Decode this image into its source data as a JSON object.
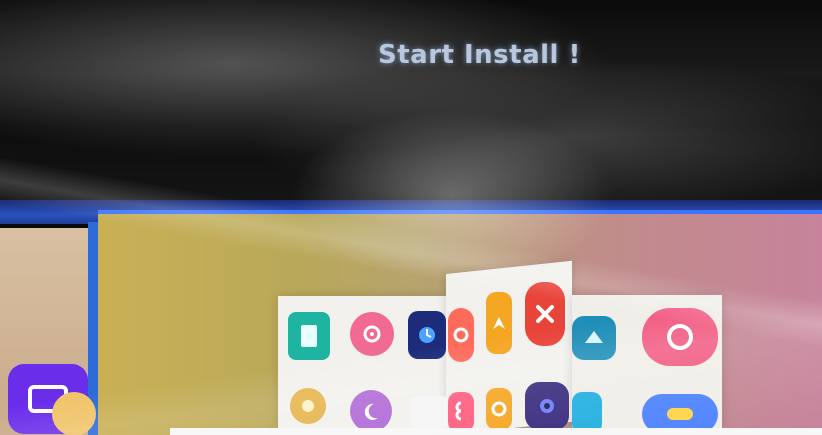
{
  "screen": {
    "title": "Start Install !"
  },
  "icons": [
    "document-icon",
    "gear-icon",
    "clock-icon",
    "settings-icon",
    "compass-icon",
    "close-icon",
    "mail-icon",
    "music-icon",
    "medal-icon",
    "moon-icon",
    "window-icon",
    "number-icon",
    "timer-icon",
    "camera-icon",
    "phone-icon",
    "chat-icon",
    "gallery-icon",
    "weather-icon"
  ]
}
